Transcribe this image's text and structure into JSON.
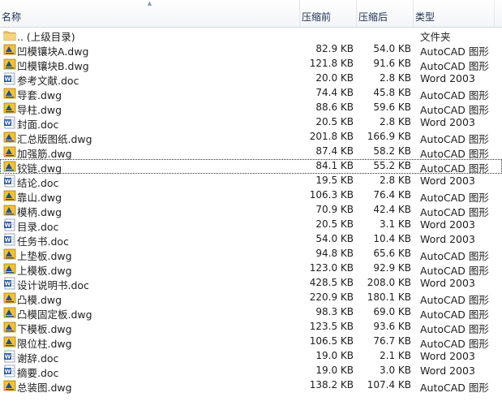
{
  "columns": {
    "name": "名称",
    "compressed": "压缩前",
    "original": "压缩后",
    "type": "类型"
  },
  "rows": [
    {
      "icon": "folder-icon",
      "name": ".. (上级目录)",
      "compressed": "",
      "original": "",
      "type": "文件夹"
    },
    {
      "icon": "dwg-file-icon",
      "name": "凹模镶块A.dwg",
      "compressed": "82.9 KB",
      "original": "54.0 KB",
      "type": "AutoCAD 图形"
    },
    {
      "icon": "dwg-file-icon",
      "name": "凹模镶块B.dwg",
      "compressed": "121.8 KB",
      "original": "91.6 KB",
      "type": "AutoCAD 图形"
    },
    {
      "icon": "word-doc-icon",
      "name": "参考文献.doc",
      "compressed": "20.0 KB",
      "original": "2.8 KB",
      "type": "Word 2003"
    },
    {
      "icon": "dwg-file-icon",
      "name": "导套.dwg",
      "compressed": "74.4 KB",
      "original": "45.8 KB",
      "type": "AutoCAD 图形"
    },
    {
      "icon": "dwg-file-icon",
      "name": "导柱.dwg",
      "compressed": "88.6 KB",
      "original": "59.6 KB",
      "type": "AutoCAD 图形"
    },
    {
      "icon": "word-doc-icon",
      "name": "封面.doc",
      "compressed": "20.5 KB",
      "original": "2.8 KB",
      "type": "Word 2003"
    },
    {
      "icon": "dwg-file-icon",
      "name": "汇总版图纸.dwg",
      "compressed": "201.8 KB",
      "original": "166.9 KB",
      "type": "AutoCAD 图形"
    },
    {
      "icon": "dwg-file-icon",
      "name": "加强筋.dwg",
      "compressed": "87.4 KB",
      "original": "58.2 KB",
      "type": "AutoCAD 图形"
    },
    {
      "icon": "dwg-file-icon",
      "name": "铰链.dwg",
      "compressed": "84.1 KB",
      "original": "55.2 KB",
      "type": "AutoCAD 图形",
      "focused": true
    },
    {
      "icon": "word-doc-icon",
      "name": "结论.doc",
      "compressed": "19.5 KB",
      "original": "2.8 KB",
      "type": "Word 2003"
    },
    {
      "icon": "dwg-file-icon",
      "name": "靠山.dwg",
      "compressed": "106.3 KB",
      "original": "76.4 KB",
      "type": "AutoCAD 图形"
    },
    {
      "icon": "dwg-file-icon",
      "name": "模柄.dwg",
      "compressed": "70.9 KB",
      "original": "42.4 KB",
      "type": "AutoCAD 图形"
    },
    {
      "icon": "word-doc-icon",
      "name": "目录.doc",
      "compressed": "20.5 KB",
      "original": "3.1 KB",
      "type": "Word 2003"
    },
    {
      "icon": "word-doc-icon",
      "name": "任务书.doc",
      "compressed": "54.0 KB",
      "original": "10.4 KB",
      "type": "Word 2003"
    },
    {
      "icon": "dwg-file-icon",
      "name": "上垫板.dwg",
      "compressed": "94.8 KB",
      "original": "65.6 KB",
      "type": "AutoCAD 图形"
    },
    {
      "icon": "dwg-file-icon",
      "name": "上模板.dwg",
      "compressed": "123.0 KB",
      "original": "92.9 KB",
      "type": "AutoCAD 图形"
    },
    {
      "icon": "word-doc-icon",
      "name": "设计说明书.doc",
      "compressed": "428.5 KB",
      "original": "208.0 KB",
      "type": "Word 2003"
    },
    {
      "icon": "dwg-file-icon",
      "name": "凸模.dwg",
      "compressed": "220.9 KB",
      "original": "180.1 KB",
      "type": "AutoCAD 图形"
    },
    {
      "icon": "dwg-file-icon",
      "name": "凸模固定板.dwg",
      "compressed": "98.3 KB",
      "original": "69.0 KB",
      "type": "AutoCAD 图形"
    },
    {
      "icon": "dwg-file-icon",
      "name": "下模板.dwg",
      "compressed": "123.5 KB",
      "original": "93.6 KB",
      "type": "AutoCAD 图形"
    },
    {
      "icon": "dwg-file-icon",
      "name": "限位柱.dwg",
      "compressed": "106.5 KB",
      "original": "76.7 KB",
      "type": "AutoCAD 图形"
    },
    {
      "icon": "word-doc-icon",
      "name": "谢辞.doc",
      "compressed": "19.0 KB",
      "original": "2.1 KB",
      "type": "Word 2003"
    },
    {
      "icon": "word-doc-icon",
      "name": "摘要.doc",
      "compressed": "19.0 KB",
      "original": "3.0 KB",
      "type": "Word 2003"
    },
    {
      "icon": "dwg-file-icon",
      "name": "总装图.dwg",
      "compressed": "138.2 KB",
      "original": "107.4 KB",
      "type": "AutoCAD 图形"
    }
  ]
}
